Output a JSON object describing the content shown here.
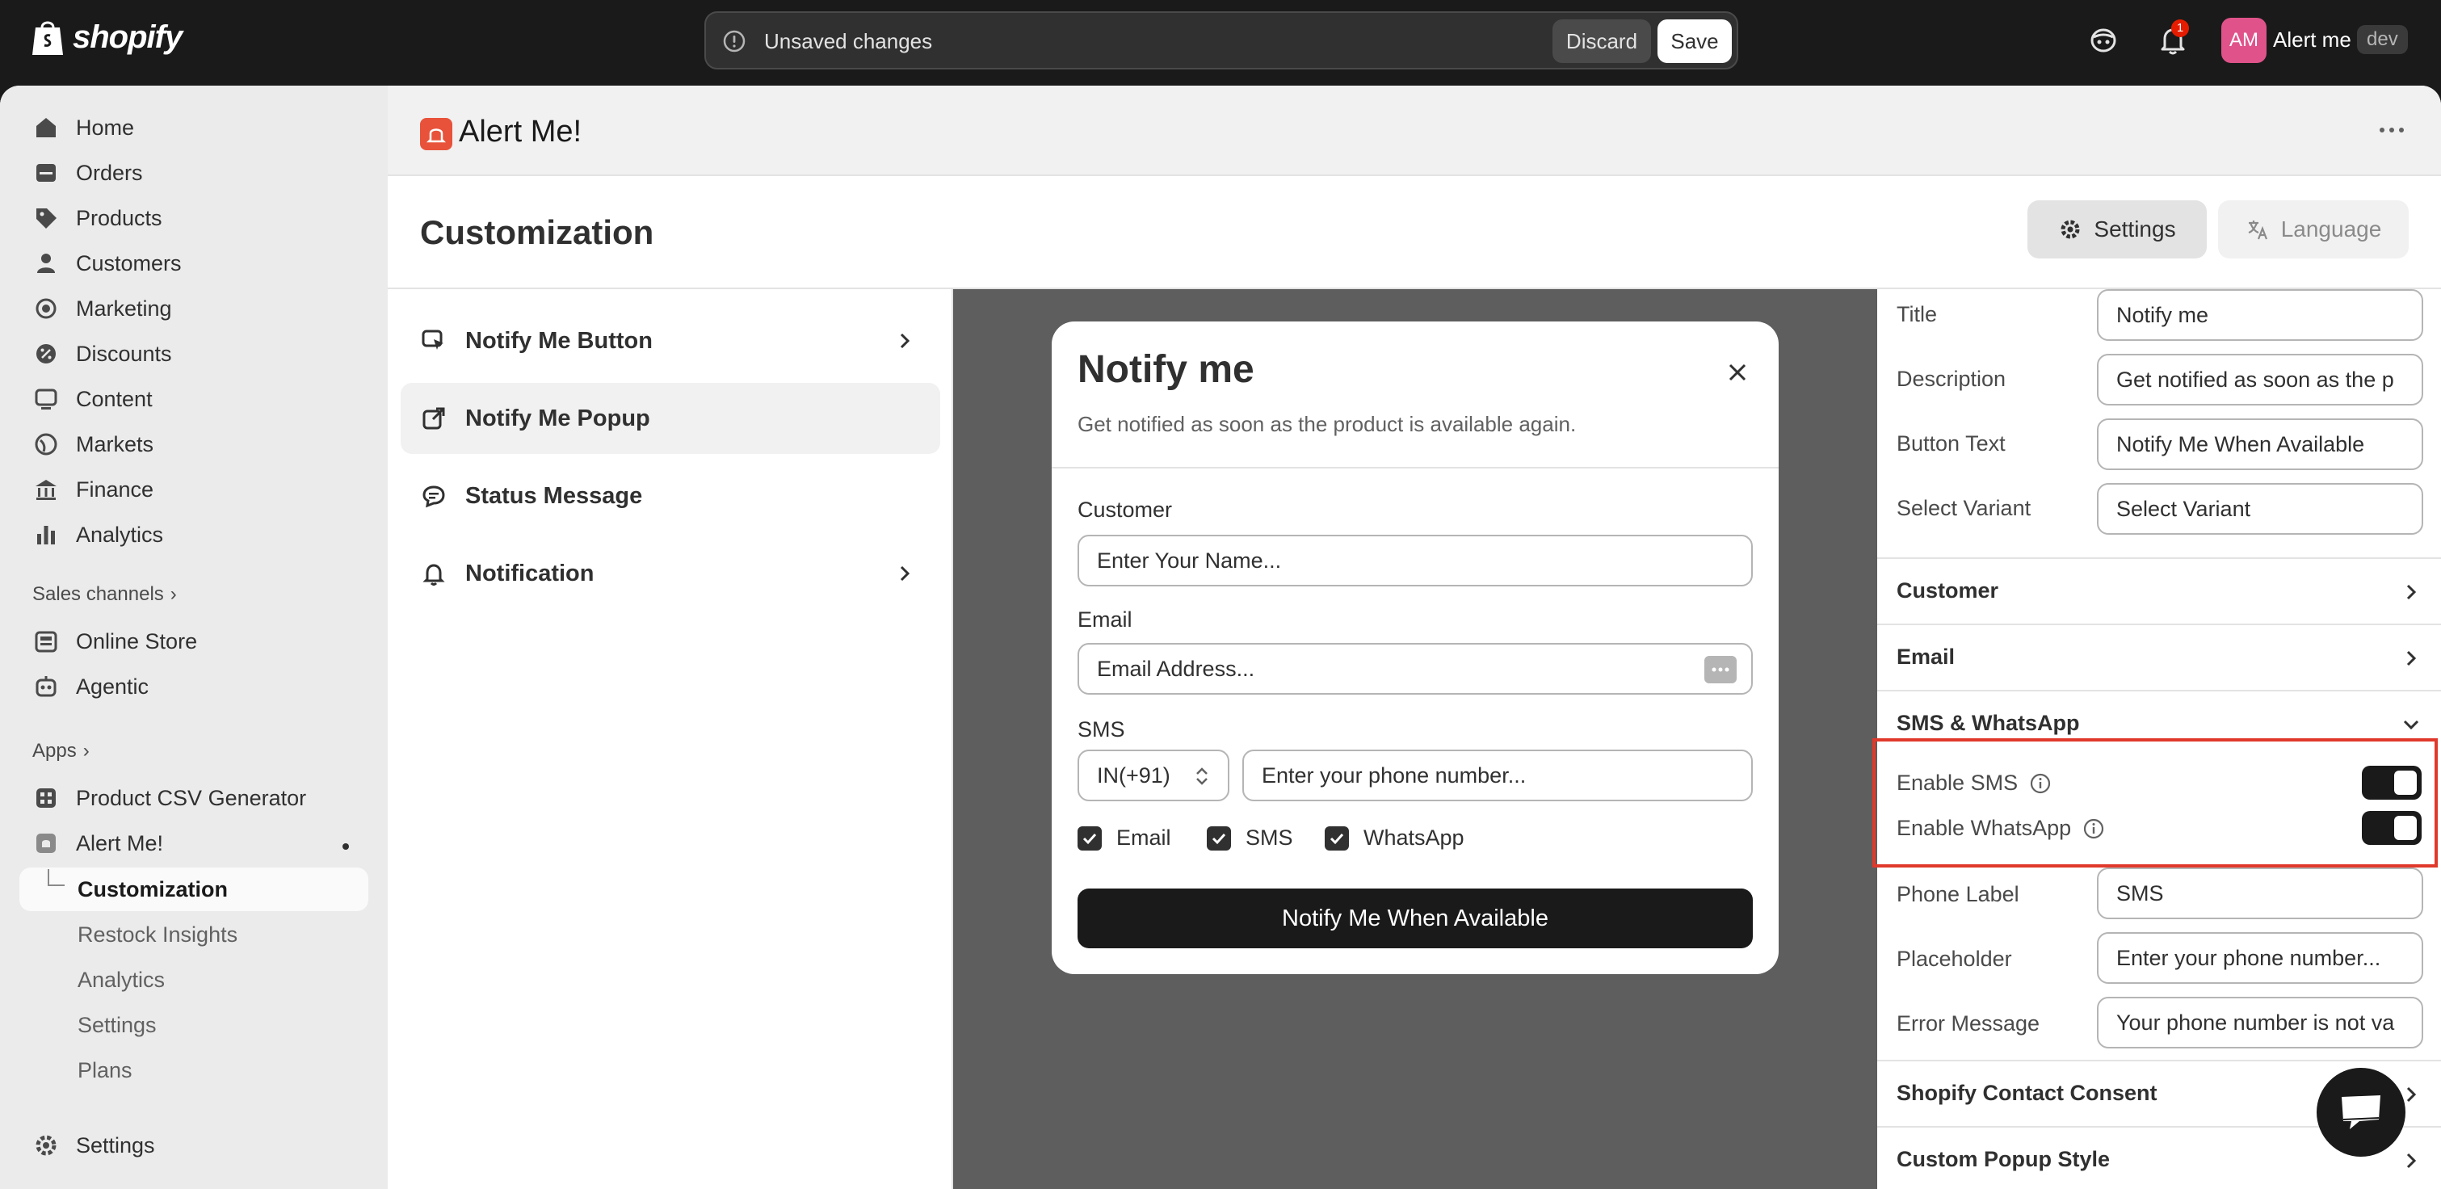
{
  "topbar": {
    "brand": "shopify",
    "unsaved_text": "Unsaved changes",
    "discard_label": "Discard",
    "save_label": "Save",
    "notification_count": "1",
    "avatar_initials": "AM",
    "store_name": "Alert me",
    "store_badge": "dev"
  },
  "sidebar": {
    "items": [
      {
        "label": "Home",
        "icon": "home-icon"
      },
      {
        "label": "Orders",
        "icon": "orders-icon"
      },
      {
        "label": "Products",
        "icon": "tag-icon"
      },
      {
        "label": "Customers",
        "icon": "person-icon"
      },
      {
        "label": "Marketing",
        "icon": "target-icon"
      },
      {
        "label": "Discounts",
        "icon": "discount-icon"
      },
      {
        "label": "Content",
        "icon": "content-icon"
      },
      {
        "label": "Markets",
        "icon": "globe-icon"
      },
      {
        "label": "Finance",
        "icon": "bank-icon"
      },
      {
        "label": "Analytics",
        "icon": "bar-chart-icon"
      }
    ],
    "sales_channels_label": "Sales channels",
    "sales_channels": [
      {
        "label": "Online Store",
        "icon": "store-icon"
      },
      {
        "label": "Agentic",
        "icon": "bot-icon"
      }
    ],
    "apps_label": "Apps",
    "apps": [
      {
        "label": "Product CSV Generator",
        "icon": "apps-grid-icon"
      },
      {
        "label": "Alert Me!",
        "icon": "alert-app-icon"
      }
    ],
    "app_subitems": [
      "Customization",
      "Restock Insights",
      "Analytics",
      "Settings",
      "Plans"
    ],
    "settings_label": "Settings"
  },
  "app": {
    "title": "Alert Me!",
    "page_title": "Customization",
    "settings_button": "Settings",
    "language_button": "Language"
  },
  "menu": {
    "items": [
      {
        "label": "Notify Me Button",
        "has_chevron": true
      },
      {
        "label": "Notify Me Popup",
        "has_chevron": false
      },
      {
        "label": "Status Message",
        "has_chevron": false
      },
      {
        "label": "Notification",
        "has_chevron": true
      }
    ]
  },
  "popup": {
    "title": "Notify me",
    "description": "Get notified as soon as the product is available again.",
    "customer_label": "Customer",
    "customer_placeholder": "Enter Your Name...",
    "email_label": "Email",
    "email_placeholder": "Email Address...",
    "sms_label": "SMS",
    "country_code": "IN(+91)",
    "phone_placeholder": "Enter your phone number...",
    "checkboxes": [
      "Email",
      "SMS",
      "WhatsApp"
    ],
    "submit_label": "Notify Me When Available"
  },
  "settings_panel": {
    "fields": [
      {
        "label": "Title",
        "value": "Notify me"
      },
      {
        "label": "Description",
        "value": "Get notified as soon as the p"
      },
      {
        "label": "Button Text",
        "value": "Notify Me When Available"
      },
      {
        "label": "Select Variant",
        "value": "Select Variant"
      }
    ],
    "sections": {
      "customer": "Customer",
      "email": "Email",
      "sms_whatsapp": "SMS & WhatsApp",
      "shopify_consent": "Shopify Contact Consent",
      "custom_style": "Custom Popup Style"
    },
    "toggles": [
      {
        "label": "Enable SMS",
        "on": true
      },
      {
        "label": "Enable WhatsApp",
        "on": true
      }
    ],
    "sms_fields": [
      {
        "label": "Phone Label",
        "value": "SMS"
      },
      {
        "label": "Placeholder",
        "value": "Enter your phone number..."
      },
      {
        "label": "Error Message",
        "value": "Your phone number is not va"
      }
    ]
  },
  "colors": {
    "accent_dark": "#1a1a1a",
    "highlight": "#e0392b",
    "app_logo": "#e8523a",
    "avatar": "#e0538a"
  }
}
